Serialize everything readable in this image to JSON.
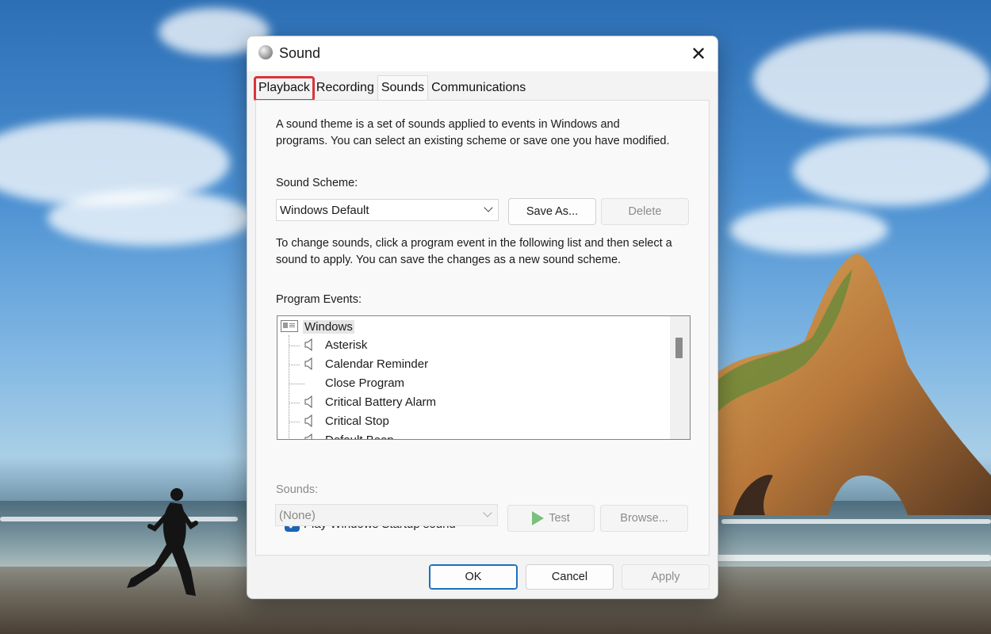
{
  "window": {
    "title": "Sound",
    "close_glyph": "✕"
  },
  "tabs": [
    {
      "label": "Playback",
      "highlighted": true
    },
    {
      "label": "Recording"
    },
    {
      "label": "Sounds",
      "active": true
    },
    {
      "label": "Communications"
    }
  ],
  "sounds_tab": {
    "description": "A sound theme is a set of sounds applied to events in Windows and programs.  You can select an existing scheme or save one you have modified.",
    "scheme_label": "Sound Scheme:",
    "scheme_value": "Windows Default",
    "save_as_label": "Save As...",
    "delete_label": "Delete",
    "instructions": "To change sounds, click a program event in the following list and then select a sound to apply.  You can save the changes as a new sound scheme.",
    "events_label": "Program Events:",
    "events_root": "Windows",
    "events": [
      {
        "label": "Asterisk",
        "has_sound": true
      },
      {
        "label": "Calendar Reminder",
        "has_sound": true
      },
      {
        "label": "Close Program",
        "has_sound": false
      },
      {
        "label": "Critical Battery Alarm",
        "has_sound": true
      },
      {
        "label": "Critical Stop",
        "has_sound": true
      },
      {
        "label": "Default Beep",
        "has_sound": true
      }
    ],
    "startup_sound_label": "Play Windows Startup sound",
    "startup_sound_checked": true,
    "sounds_label": "Sounds:",
    "sounds_value": "(None)",
    "test_label": "Test",
    "browse_label": "Browse..."
  },
  "footer": {
    "ok_label": "OK",
    "cancel_label": "Cancel",
    "apply_label": "Apply"
  },
  "colors": {
    "highlight_outline": "#d9343a",
    "checkbox_accent": "#1963b8",
    "primary_border": "#1d6fc0"
  }
}
